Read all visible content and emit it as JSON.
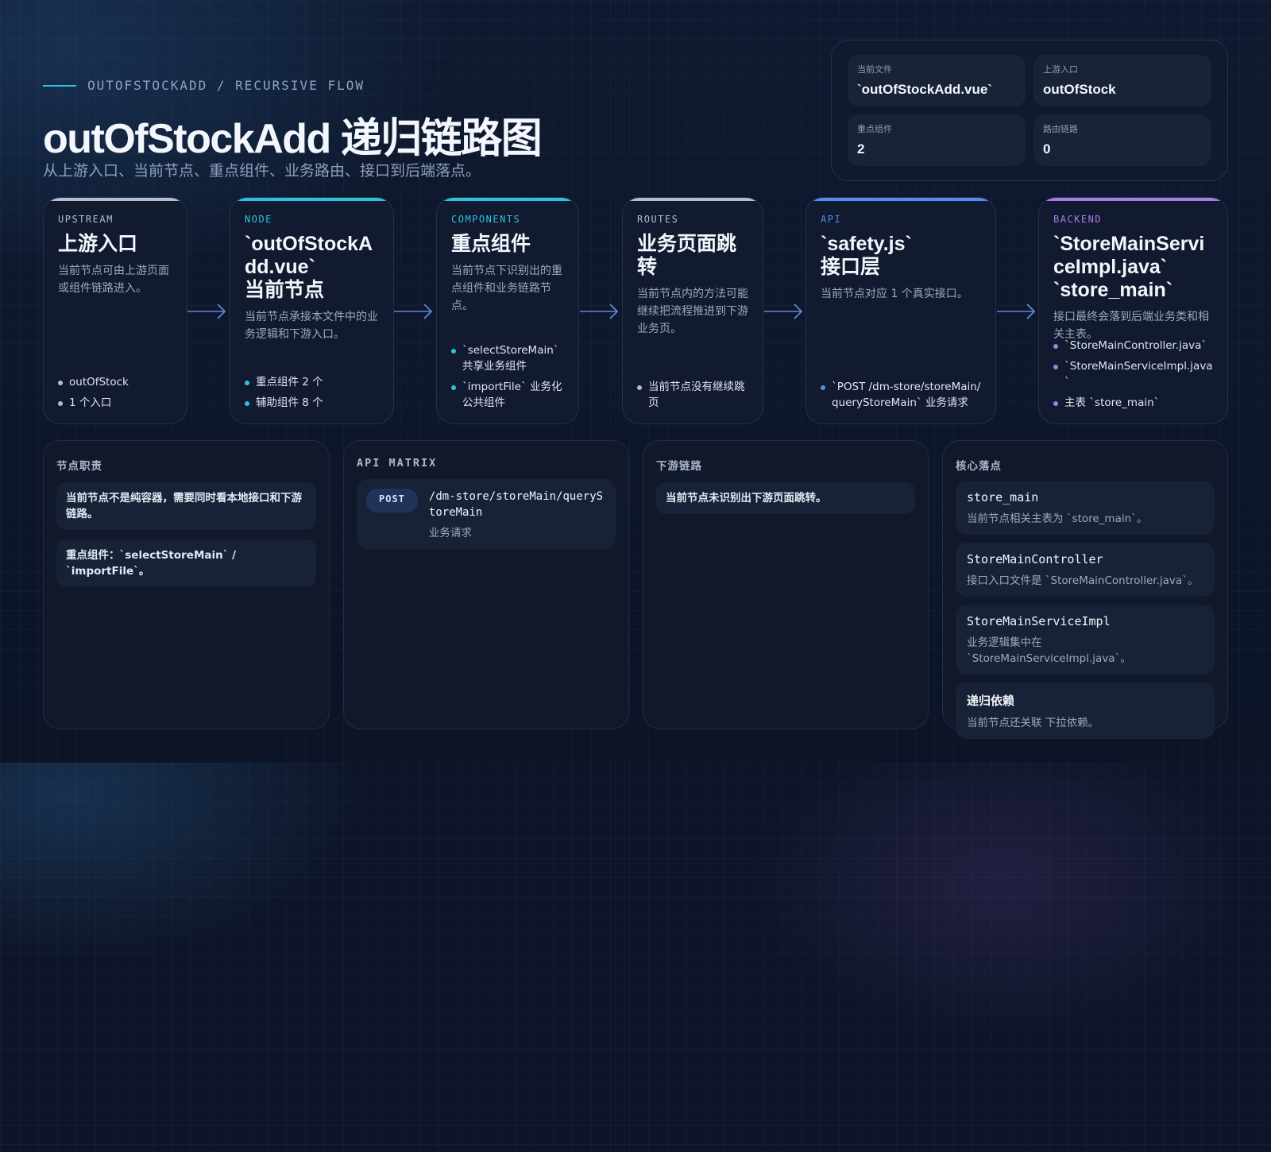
{
  "header": {
    "kicker": "OUTOFSTOCKADD / RECURSIVE FLOW",
    "title": "outOfStockAdd 递归链路图",
    "subtitle": "从上游入口、当前节点、重点组件、业务路由、接口到后端落点。"
  },
  "stats": [
    {
      "label": "当前文件",
      "value": "`outOfStockAdd.vue`"
    },
    {
      "label": "上游入口",
      "value": "outOfStock"
    },
    {
      "label": "重点组件",
      "value": "2"
    },
    {
      "label": "路由链路",
      "value": "0"
    }
  ],
  "colors": {
    "upstream": "#b3bccb",
    "node": "#2cc3e0",
    "components": "#2cc3e0",
    "routes": "#b3bccb",
    "api": "#4f8df5",
    "backend": "#a77de8",
    "arrow": "#5e86d6"
  },
  "cards": {
    "upstream": {
      "tag": "UPSTREAM",
      "title": "上游入口",
      "desc": "当前节点可由上游页面或组件链路进入。",
      "bullets": [
        "outOfStock",
        "1 个入口"
      ]
    },
    "node": {
      "tag": "NODE",
      "title": "`outOfStockAdd.vue`",
      "title2": "当前节点",
      "desc": "当前节点承接本文件中的业务逻辑和下游入口。",
      "bullets": [
        "重点组件 2 个",
        "辅助组件 8 个"
      ]
    },
    "components": {
      "tag": "COMPONENTS",
      "title": "重点组件",
      "desc": "当前节点下识别出的重点组件和业务链路节点。",
      "bullets": [
        "`selectStoreMain` 共享业务组件",
        "`importFile` 业务化公共组件"
      ]
    },
    "routes": {
      "tag": "ROUTES",
      "title": "业务页面跳转",
      "desc": "当前节点内的方法可能继续把流程推进到下游业务页。",
      "bullets": [
        "当前节点没有继续跳页"
      ]
    },
    "api": {
      "tag": "API",
      "title": "`safety.js`",
      "title2": "接口层",
      "desc": "当前节点对应 1 个真实接口。",
      "bullets": [
        "`POST /dm-store/storeMain/queryStoreMain` 业务请求"
      ]
    },
    "backend": {
      "tag": "BACKEND",
      "title": "`StoreMainServiceImpl.java`",
      "title2": "`store_main`",
      "desc": "接口最终会落到后端业务类和相关主表。",
      "bullets": [
        "`StoreMainController.java`",
        "`StoreMainServiceImpl.java`",
        "主表 `store_main`"
      ]
    }
  },
  "panels": {
    "duty": {
      "title": "节点职责",
      "notes": [
        "当前节点不是纯容器，需要同时看本地接口和下游链路。",
        "重点组件：`selectStoreMain` / `importFile`。"
      ]
    },
    "api_matrix": {
      "title": "API MATRIX",
      "method": "POST",
      "path": "/dm-store/storeMain/queryStoreMain",
      "desc": "业务请求"
    },
    "downstream": {
      "title": "下游链路",
      "notes": [
        "当前节点未识别出下游页面跳转。"
      ]
    },
    "core": {
      "title": "核心落点",
      "items": [
        {
          "name": "store_main",
          "desc": "当前节点相关主表为 `store_main`。"
        },
        {
          "name": "StoreMainController",
          "desc": "接口入口文件是 `StoreMainController.java`。"
        },
        {
          "name": "StoreMainServiceImpl",
          "desc": "业务逻辑集中在 `StoreMainServiceImpl.java`。"
        },
        {
          "name": "递归依赖",
          "desc": "当前节点还关联 下拉依赖。"
        }
      ]
    }
  }
}
